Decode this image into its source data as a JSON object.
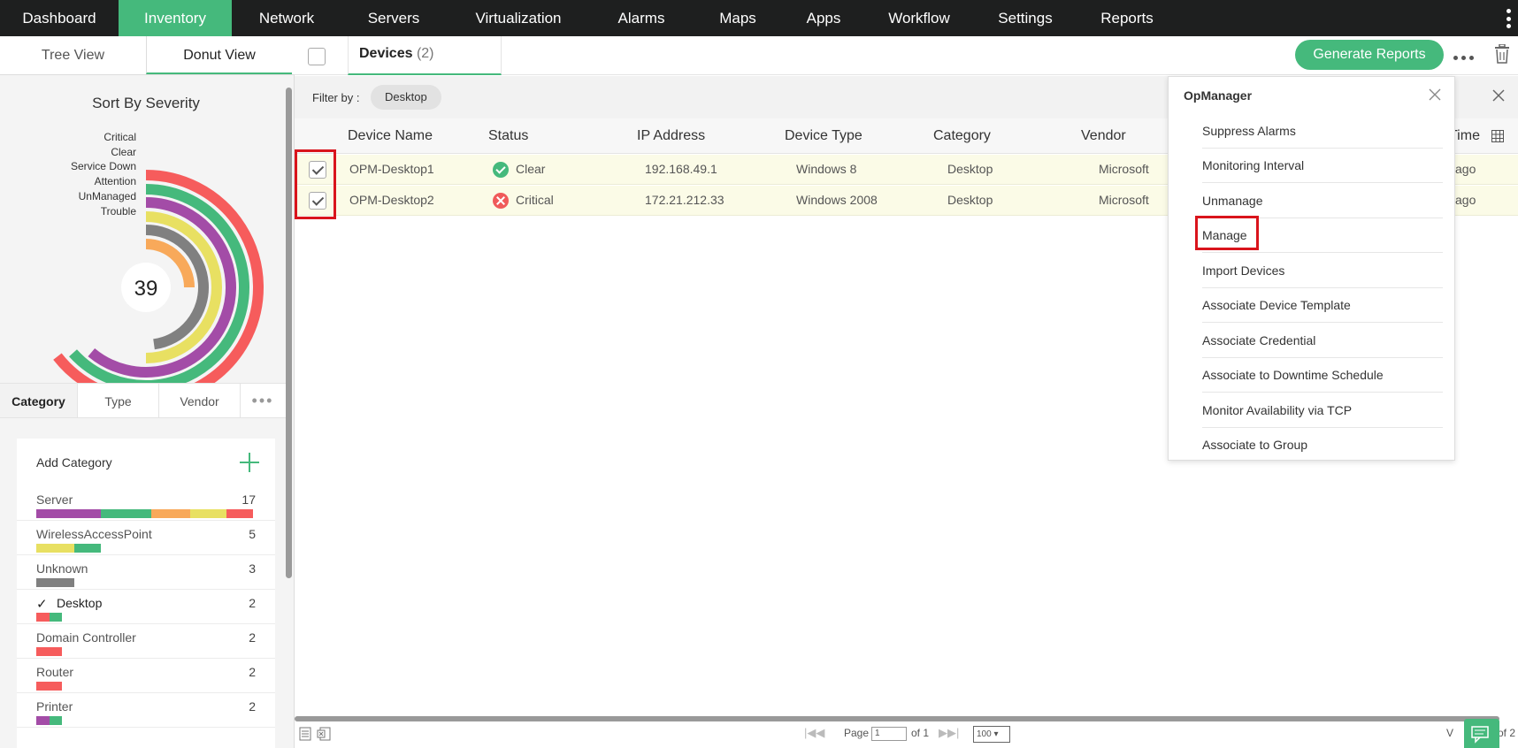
{
  "nav": {
    "items": [
      {
        "label": "Dashboard",
        "active": false
      },
      {
        "label": "Inventory",
        "active": true
      },
      {
        "label": "Network",
        "active": false
      },
      {
        "label": "Servers",
        "active": false
      },
      {
        "label": "Virtualization",
        "active": false
      },
      {
        "label": "Alarms",
        "active": false
      },
      {
        "label": "Maps",
        "active": false
      },
      {
        "label": "Apps",
        "active": false
      },
      {
        "label": "Workflow",
        "active": false
      },
      {
        "label": "Settings",
        "active": false
      },
      {
        "label": "Reports",
        "active": false
      }
    ]
  },
  "left": {
    "view_tabs": {
      "tree": "Tree View",
      "donut": "Donut View"
    },
    "donut": {
      "title": "Sort By Severity",
      "total": "39",
      "severities": [
        {
          "label": "Critical",
          "color": "#f65c5c"
        },
        {
          "label": "Clear",
          "color": "#45b97c"
        },
        {
          "label": "Service Down",
          "color": "#a34ca7"
        },
        {
          "label": "Attention",
          "color": "#e8e062"
        },
        {
          "label": "UnManaged",
          "color": "#808080"
        },
        {
          "label": "Trouble",
          "color": "#f8a95a"
        }
      ]
    },
    "cat_tabs": {
      "category": "Category",
      "type": "Type",
      "vendor": "Vendor",
      "more": "•••"
    },
    "add_category": "Add Category",
    "categories": [
      {
        "name": "Server",
        "count": "17"
      },
      {
        "name": "WirelessAccessPoint",
        "count": "5"
      },
      {
        "name": "Unknown",
        "count": "3"
      },
      {
        "name": "Desktop",
        "count": "2"
      },
      {
        "name": "Domain Controller",
        "count": "2"
      },
      {
        "name": "Router",
        "count": "2"
      },
      {
        "name": "Printer",
        "count": "2"
      }
    ]
  },
  "main": {
    "devices_label": "Devices",
    "devices_count": "(2)",
    "generate_reports": "Generate Reports",
    "filter_label": "Filter by :",
    "filter_chip": "Desktop",
    "columns": [
      "Device Name",
      "Status",
      "IP Address",
      "Device Type",
      "Category",
      "Vendor",
      "Time"
    ],
    "rows": [
      {
        "name": "OPM-Desktop1",
        "status": "Clear",
        "ip": "192.168.49.1",
        "type": "Windows 8",
        "category": "Desktop",
        "vendor": "Microsoft",
        "time": "ago"
      },
      {
        "name": "OPM-Desktop2",
        "status": "Critical",
        "ip": "172.21.212.33",
        "type": "Windows 2008",
        "category": "Desktop",
        "vendor": "Microsoft",
        "time": "ago"
      }
    ],
    "pager": {
      "page_label": "Page",
      "page_value": "1",
      "of_label": "of 1",
      "per_page": "100",
      "right_text_a": "V",
      "right_text_b": "of 2"
    }
  },
  "menu": {
    "title": "OpManager",
    "items": [
      "Suppress Alarms",
      "Monitoring Interval",
      "Unmanage",
      "Manage",
      "Import Devices",
      "Associate Device Template",
      "Associate Credential",
      "Associate to Downtime Schedule",
      "Monitor Availability via TCP",
      "Associate to Group"
    ]
  },
  "colors": {
    "accent": "#45b97c",
    "nav_bg": "#1e1f1f",
    "highlight": "#d9141c",
    "row_bg": "#fbfbe7"
  }
}
